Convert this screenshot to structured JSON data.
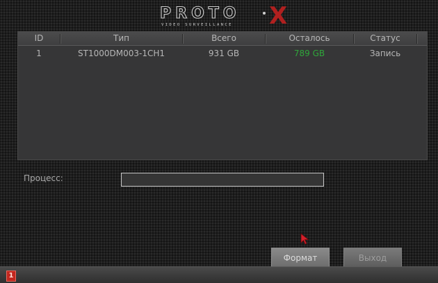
{
  "brand": {
    "name": "PROTO",
    "x": "X",
    "tagline": "VIDEO SURVEILLANCE"
  },
  "table": {
    "columns": [
      "ID",
      "Тип",
      "Всего",
      "Осталось",
      "Статус"
    ],
    "rows": [
      {
        "id": "1",
        "type": "ST1000DM003-1CH1",
        "total": "931 GB",
        "remaining": "789 GB",
        "status": "Запись"
      }
    ]
  },
  "process": {
    "label": "Процесс:"
  },
  "buttons": {
    "format": "Формат",
    "exit": "Выход"
  },
  "statusbar": {
    "icon_text": "1"
  },
  "colors": {
    "accent_red": "#c2261e",
    "remaining_green": "#2fa63a"
  }
}
